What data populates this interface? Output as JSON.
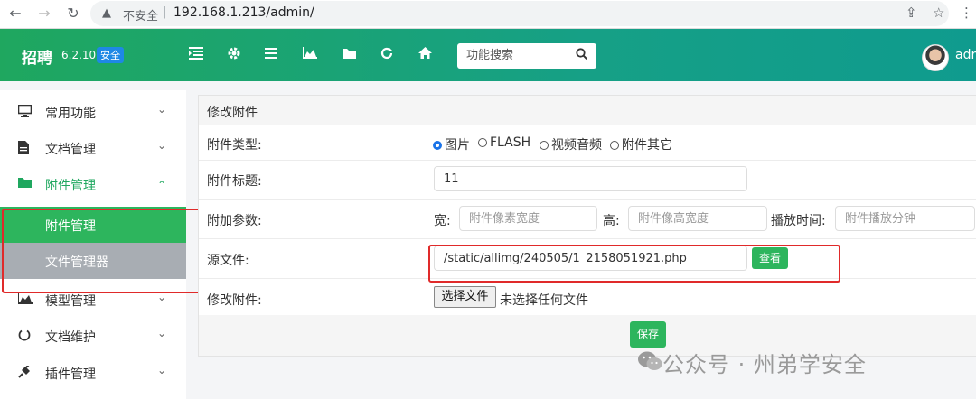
{
  "browser": {
    "back_icon": "←",
    "forward_icon": "→",
    "reload_icon": "↻",
    "warning_icon": "▲",
    "insecure_label": "不安全",
    "separator": "|",
    "url": "192.168.1.213/admin/",
    "share_icon": "⇪",
    "star_icon": "☆",
    "menu_icon": "⋮"
  },
  "header": {
    "brand": "招聘",
    "version": "6.2.10",
    "badge": "安全",
    "icons": [
      "list-indent-icon",
      "gear-icon",
      "menu-icon",
      "chart-icon",
      "folder-icon",
      "refresh-icon",
      "home-icon"
    ],
    "search_placeholder": "功能搜索",
    "user_name": "adr"
  },
  "sidebar": {
    "items": [
      {
        "label": "常用功能",
        "icon": "monitor-icon"
      },
      {
        "label": "文档管理",
        "icon": "document-icon"
      },
      {
        "label": "附件管理",
        "icon": "folder-icon"
      },
      {
        "label": "模型管理",
        "icon": "chart-icon"
      },
      {
        "label": "文档维护",
        "icon": "power-icon"
      },
      {
        "label": "插件管理",
        "icon": "plug-icon"
      }
    ],
    "sub_items": [
      {
        "label": "附件管理"
      },
      {
        "label": "文件管理器"
      }
    ]
  },
  "form": {
    "title": "修改附件",
    "type_label": "附件类型:",
    "type_options": [
      "图片",
      "FLASH",
      "视频音频",
      "附件其它"
    ],
    "type_selected": "图片",
    "title_label": "附件标题:",
    "title_value": "11",
    "params_label": "附加参数:",
    "width_label": "宽:",
    "width_placeholder": "附件像素宽度",
    "height_label": "高:",
    "height_placeholder": "附件像高宽度",
    "duration_label": "播放时间:",
    "duration_placeholder": "附件播放分钟",
    "source_label": "源文件:",
    "source_value": "/static/allimg/240505/1_2158051921.php",
    "view_button": "查看",
    "modify_label": "修改附件:",
    "choose_file_button": "选择文件",
    "no_file_text": "未选择任何文件",
    "save_button": "保存"
  },
  "watermark": {
    "text": "公众号 · 州弟学安全"
  },
  "colors": {
    "brand_green": "#1fa75f",
    "header_end": "#0f9b8e",
    "active_sub": "#2db55d",
    "inactive_sub": "#a8adb3",
    "highlight_red": "#e02a2a",
    "badge_blue": "#1e88e5"
  }
}
